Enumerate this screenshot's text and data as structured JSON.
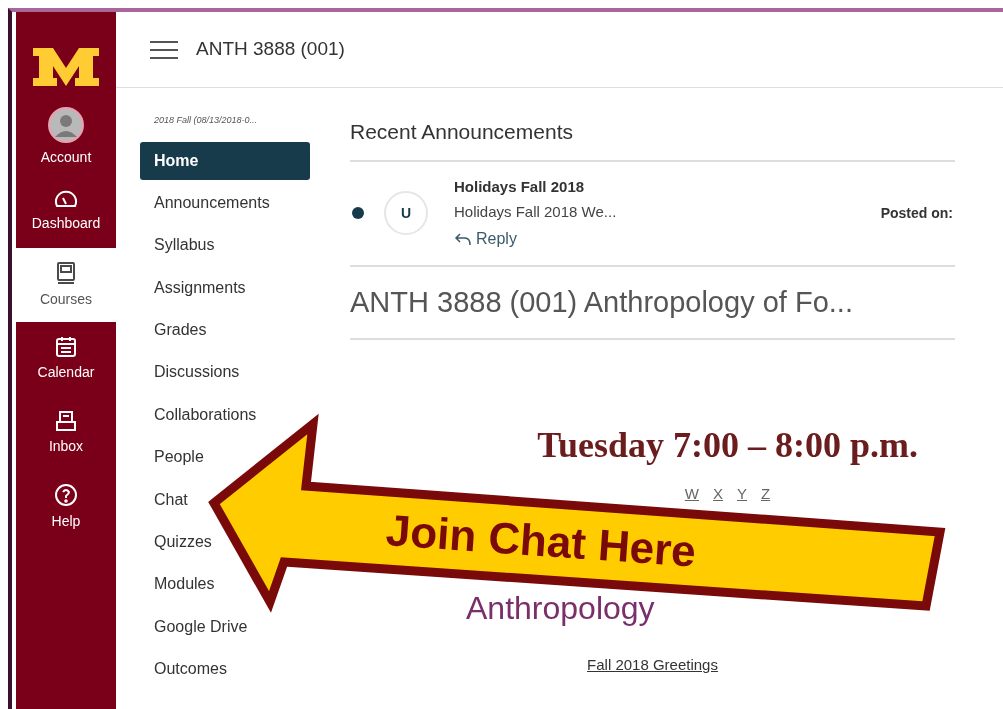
{
  "global_nav": [
    {
      "kind": "account",
      "label": "Account",
      "selected": false
    },
    {
      "kind": "dashboard",
      "label": "Dashboard",
      "selected": false
    },
    {
      "kind": "courses",
      "label": "Courses",
      "selected": true
    },
    {
      "kind": "calendar",
      "label": "Calendar",
      "selected": false
    },
    {
      "kind": "inbox",
      "label": "Inbox",
      "selected": false
    },
    {
      "kind": "help",
      "label": "Help",
      "selected": false
    }
  ],
  "header": {
    "title": "ANTH 3888 (001)"
  },
  "course_nav": {
    "term": "2018 Fall (08/13/2018-0...",
    "items": [
      {
        "label": "Home",
        "selected": true
      },
      {
        "label": "Announcements",
        "selected": false
      },
      {
        "label": "Syllabus",
        "selected": false
      },
      {
        "label": "Assignments",
        "selected": false
      },
      {
        "label": "Grades",
        "selected": false
      },
      {
        "label": "Discussions",
        "selected": false
      },
      {
        "label": "Collaborations",
        "selected": false
      },
      {
        "label": "People",
        "selected": false
      },
      {
        "label": "Chat",
        "selected": false
      },
      {
        "label": "Quizzes",
        "selected": false
      },
      {
        "label": "Modules",
        "selected": false
      },
      {
        "label": "Google Drive",
        "selected": false
      },
      {
        "label": "Outcomes",
        "selected": false
      }
    ]
  },
  "recent_announcements": {
    "title": "Recent Announcements",
    "items": [
      {
        "unread": true,
        "avatar": "U",
        "title": "Holidays Fall 2018",
        "excerpt": "Holidays Fall 2018 We...",
        "reply": "Reply",
        "posted": "Posted on:"
      }
    ]
  },
  "course_heading": "ANTH 3888 (001) Anthropology of Fo...",
  "letters": [
    "W",
    "X",
    "Y",
    "Z"
  ],
  "page_heading": "Anthropology",
  "greetings_link": "Fall 2018 Greetings",
  "annotation": {
    "time": "Tuesday 7:00 – 8:00 p.m.",
    "arrow_text": "Join Chat Here"
  }
}
